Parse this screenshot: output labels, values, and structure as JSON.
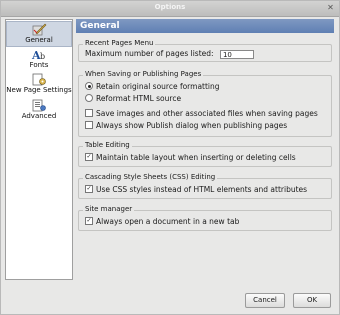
{
  "window": {
    "title": "Options"
  },
  "sidebar": {
    "items": [
      {
        "label": "General",
        "icon": "pen-icon"
      },
      {
        "label": "Fonts",
        "icon": "font-icon"
      },
      {
        "label": "New Page Settings",
        "icon": "page-settings-icon"
      },
      {
        "label": "Advanced",
        "icon": "advanced-icon"
      }
    ],
    "selected": "General"
  },
  "panel": {
    "header": "General",
    "recent_pages": {
      "title": "Recent Pages Menu",
      "max_label": "Maximum number of pages listed:",
      "max_value": "10"
    },
    "saving": {
      "title": "When Saving or Publishing Pages",
      "retain_label": "Retain original source formatting",
      "reformat_label": "Reformat HTML source",
      "save_images_label": "Save images and other associated files when saving pages",
      "show_publish_label": "Always show Publish dialog when publishing pages",
      "retain_selected": true,
      "save_images_checked": false,
      "show_publish_checked": false
    },
    "table_editing": {
      "title": "Table Editing",
      "maintain_label": "Maintain table layout when inserting or deleting cells",
      "maintain_checked": true
    },
    "css_editing": {
      "title": "Cascading Style Sheets (CSS) Editing",
      "use_css_label": "Use CSS styles instead of HTML elements and attributes",
      "use_css_checked": true
    },
    "site_manager": {
      "title": "Site manager",
      "new_tab_label": "Always open a document in a new tab",
      "new_tab_checked": true
    }
  },
  "buttons": {
    "cancel": "Cancel",
    "ok": "OK"
  }
}
